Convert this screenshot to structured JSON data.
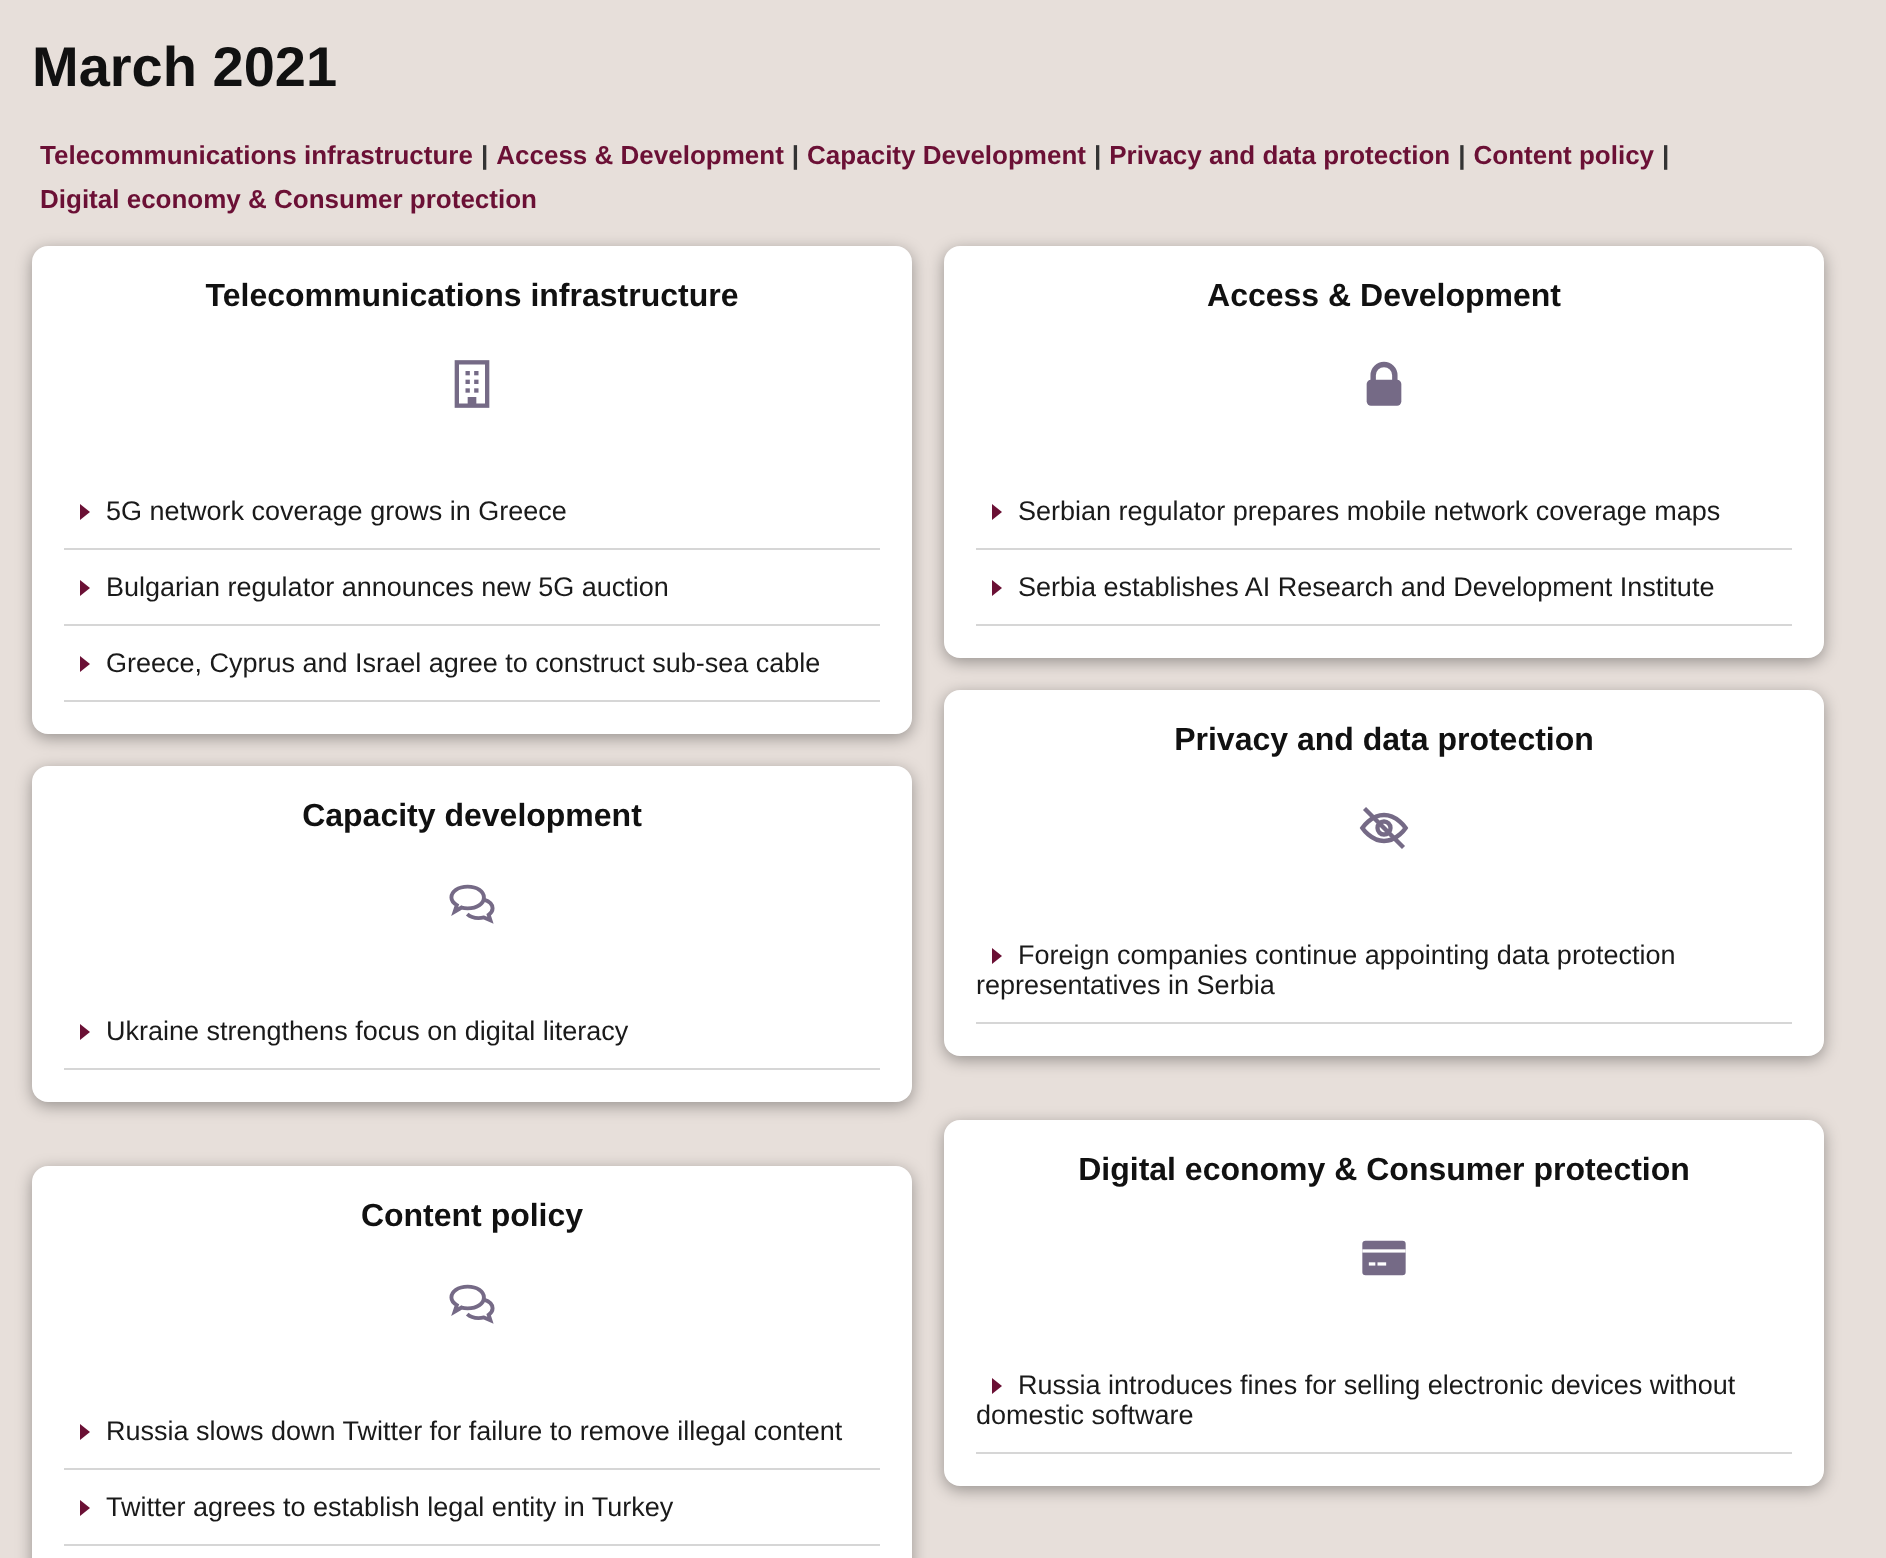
{
  "heading": "March 2021",
  "nav_separator": "|",
  "nav_links": [
    "Telecommunications infrastructure",
    "Access & Development",
    "Capacity Development",
    "Privacy and data protection",
    "Content policy",
    "Digital economy & Consumer protection"
  ],
  "columns": [
    {
      "cards": [
        {
          "title": "Telecommunications infrastructure",
          "kind": "building",
          "items": [
            "5G network coverage grows in Greece",
            "Bulgarian regulator announces new 5G auction",
            "Greece, Cyprus and Israel agree to construct sub-sea cable"
          ]
        },
        {
          "title": "Capacity development",
          "kind": "chat",
          "items": [
            "Ukraine strengthens focus on digital literacy"
          ]
        },
        {
          "title": "Content policy",
          "kind": "chat",
          "items": [
            "Russia slows down Twitter for failure to remove illegal content",
            "Twitter agrees to establish legal entity in Turkey"
          ]
        }
      ]
    },
    {
      "cards": [
        {
          "title": "Access & Development",
          "kind": "lock",
          "items": [
            "Serbian regulator prepares mobile network coverage maps",
            "Serbia establishes AI Research and Development Institute"
          ]
        },
        {
          "title": "Privacy and data protection",
          "kind": "eye-off",
          "items": [
            "Foreign companies continue appointing data protection representatives in Serbia"
          ]
        },
        {
          "title": "Digital economy & Consumer protection",
          "kind": "card",
          "items": [
            "Russia introduces fines for selling electronic devices without domestic software"
          ]
        }
      ]
    }
  ]
}
